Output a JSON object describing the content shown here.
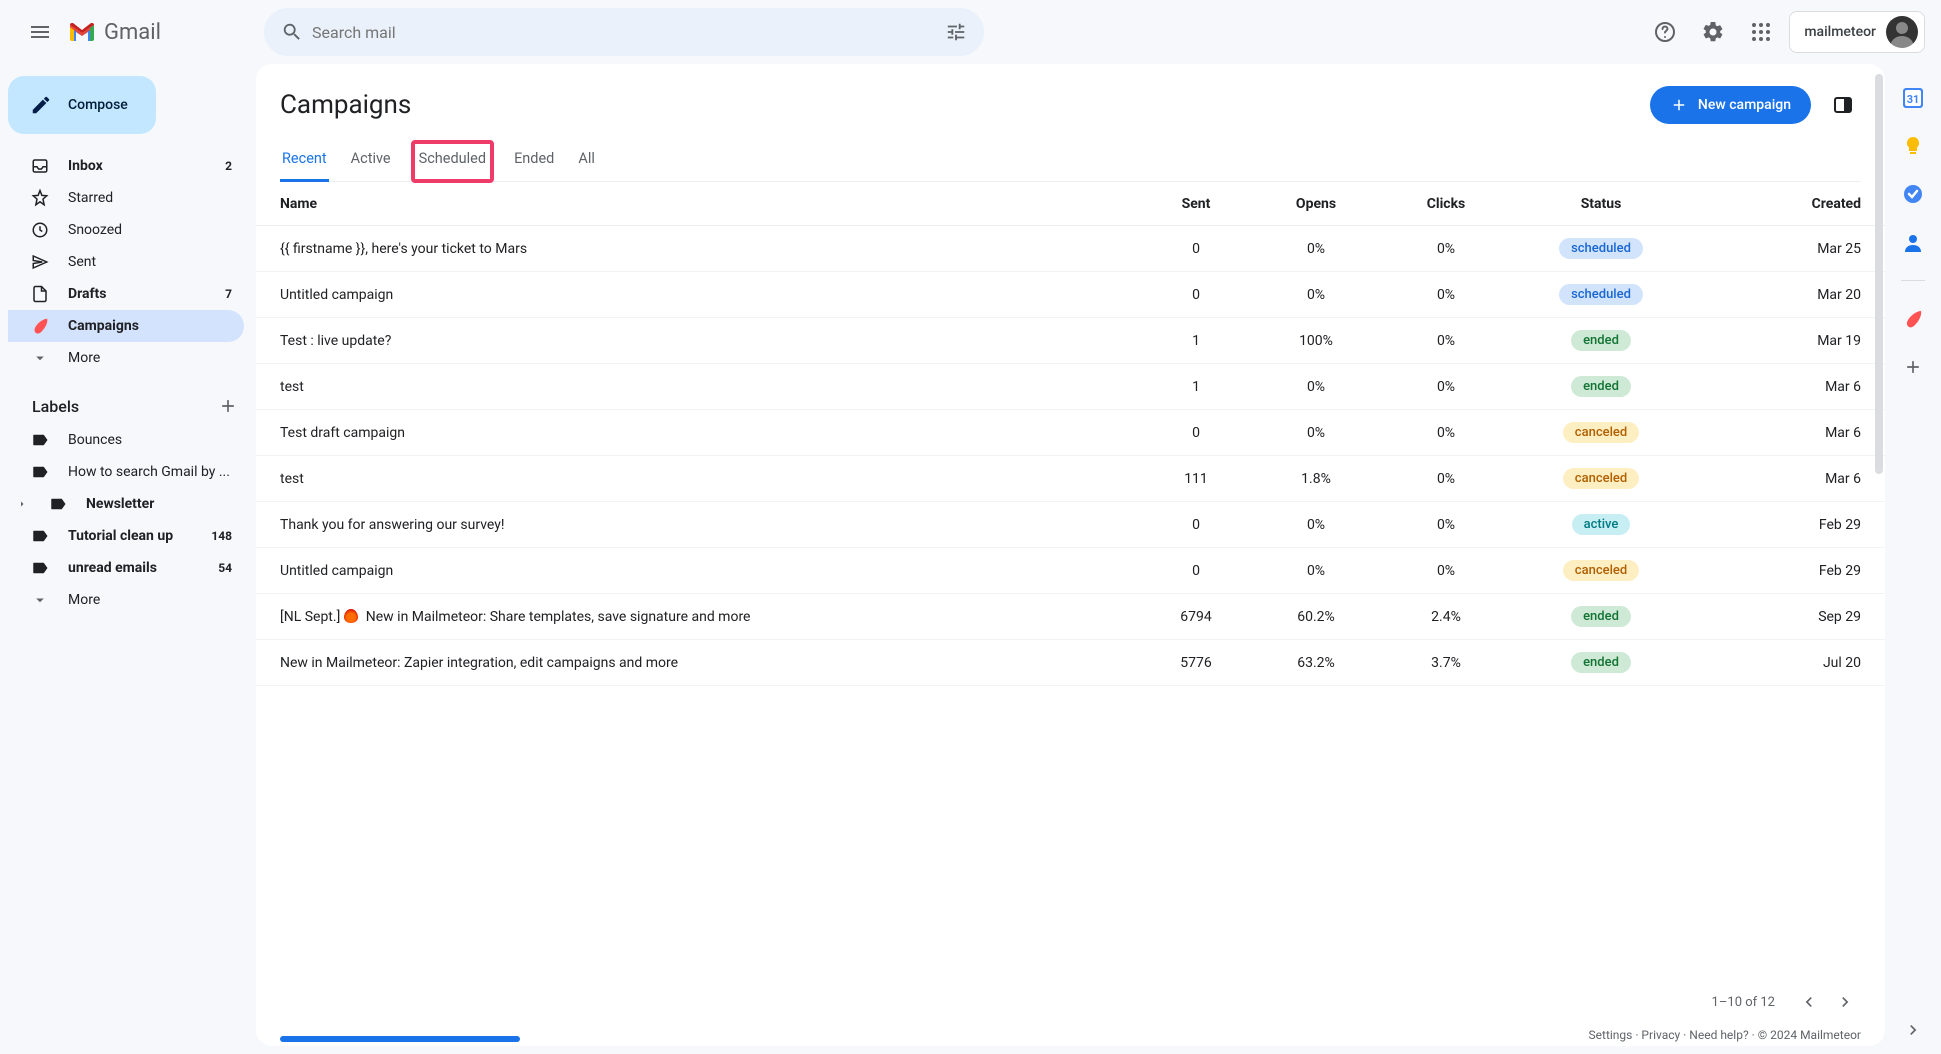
{
  "header": {
    "logo_text": "Gmail",
    "search_placeholder": "Search mail",
    "account_name": "mailmeteor"
  },
  "sidebar": {
    "compose": "Compose",
    "nav": [
      {
        "label": "Inbox",
        "count": "2",
        "bold": true
      },
      {
        "label": "Starred"
      },
      {
        "label": "Snoozed"
      },
      {
        "label": "Sent"
      },
      {
        "label": "Drafts",
        "count": "7",
        "bold": true
      },
      {
        "label": "Campaigns",
        "active": true,
        "bold": true
      },
      {
        "label": "More"
      }
    ],
    "labels_heading": "Labels",
    "labels": [
      {
        "label": "Bounces"
      },
      {
        "label": "How to search Gmail by ..."
      },
      {
        "label": "Newsletter",
        "bold": true,
        "expandable": true
      },
      {
        "label": "Tutorial clean up",
        "count": "148",
        "bold": true
      },
      {
        "label": "unread emails",
        "count": "54",
        "bold": true
      },
      {
        "label": "More"
      }
    ]
  },
  "main": {
    "title": "Campaigns",
    "new_campaign": "New campaign",
    "tabs": [
      "Recent",
      "Active",
      "Scheduled",
      "Ended",
      "All"
    ],
    "active_tab": "Recent",
    "highlight_tab": "Scheduled",
    "columns": [
      "Name",
      "Sent",
      "Opens",
      "Clicks",
      "Status",
      "Created"
    ],
    "rows": [
      {
        "name": "{{ firstname }}, here's your ticket to Mars",
        "sent": "0",
        "opens": "0%",
        "clicks": "0%",
        "status": "scheduled",
        "created": "Mar 25"
      },
      {
        "name": "Untitled campaign",
        "sent": "0",
        "opens": "0%",
        "clicks": "0%",
        "status": "scheduled",
        "created": "Mar 20"
      },
      {
        "name": "Test : live update?",
        "sent": "1",
        "opens": "100%",
        "clicks": "0%",
        "status": "ended",
        "created": "Mar 19"
      },
      {
        "name": "test",
        "sent": "1",
        "opens": "0%",
        "clicks": "0%",
        "status": "ended",
        "created": "Mar 6"
      },
      {
        "name": "Test draft campaign",
        "sent": "0",
        "opens": "0%",
        "clicks": "0%",
        "status": "canceled",
        "created": "Mar 6"
      },
      {
        "name": "test",
        "sent": "111",
        "opens": "1.8%",
        "clicks": "0%",
        "status": "canceled",
        "created": "Mar 6"
      },
      {
        "name": "Thank you for answering our survey!",
        "sent": "0",
        "opens": "0%",
        "clicks": "0%",
        "status": "active",
        "created": "Feb 29"
      },
      {
        "name": "Untitled campaign",
        "sent": "0",
        "opens": "0%",
        "clicks": "0%",
        "status": "canceled",
        "created": "Feb 29"
      },
      {
        "name": "[NL Sept.] 🔥 New in Mailmeteor: Share templates, save signature and more",
        "sent": "6794",
        "opens": "60.2%",
        "clicks": "2.4%",
        "status": "ended",
        "created": "Sep 29",
        "has_fire": true,
        "name_prefix": "[NL Sept.]",
        "name_suffix": " New in Mailmeteor: Share templates, save signature and more"
      },
      {
        "name": "New in Mailmeteor: Zapier integration, edit campaigns and more",
        "sent": "5776",
        "opens": "63.2%",
        "clicks": "3.7%",
        "status": "ended",
        "created": "Jul 20"
      }
    ],
    "pagination": "1–10 of 12",
    "footer": "Settings · Privacy · Need help? · © 2024 Mailmeteor"
  }
}
